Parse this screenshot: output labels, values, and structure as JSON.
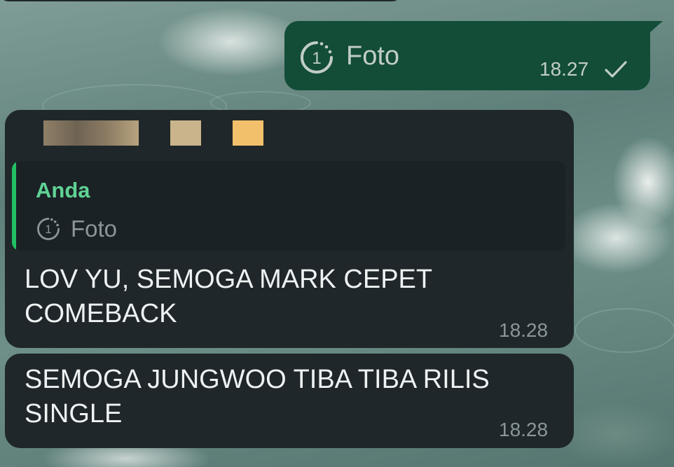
{
  "outgoing_message": {
    "icon": "view-once-icon",
    "label": "Foto",
    "time": "18.27",
    "status_icon": "single-check-icon",
    "bubble_color": "#134d37"
  },
  "incoming_messages": [
    {
      "quote": {
        "author": "Anda",
        "icon": "view-once-icon",
        "label": "Foto",
        "accent_color": "#21c063"
      },
      "text_lines": [
        "LOV YU, SEMOGA MARK CEPET",
        "COMEBACK"
      ],
      "time": "18.28"
    },
    {
      "text_lines": [
        "SEMOGA JUNGWOO TIBA TIBA RILIS",
        "SINGLE"
      ],
      "time": "18.28"
    }
  ],
  "colors": {
    "incoming_bubble": "#1f272a",
    "author_name": "#5fd394",
    "timestamp": "#8a969b"
  }
}
